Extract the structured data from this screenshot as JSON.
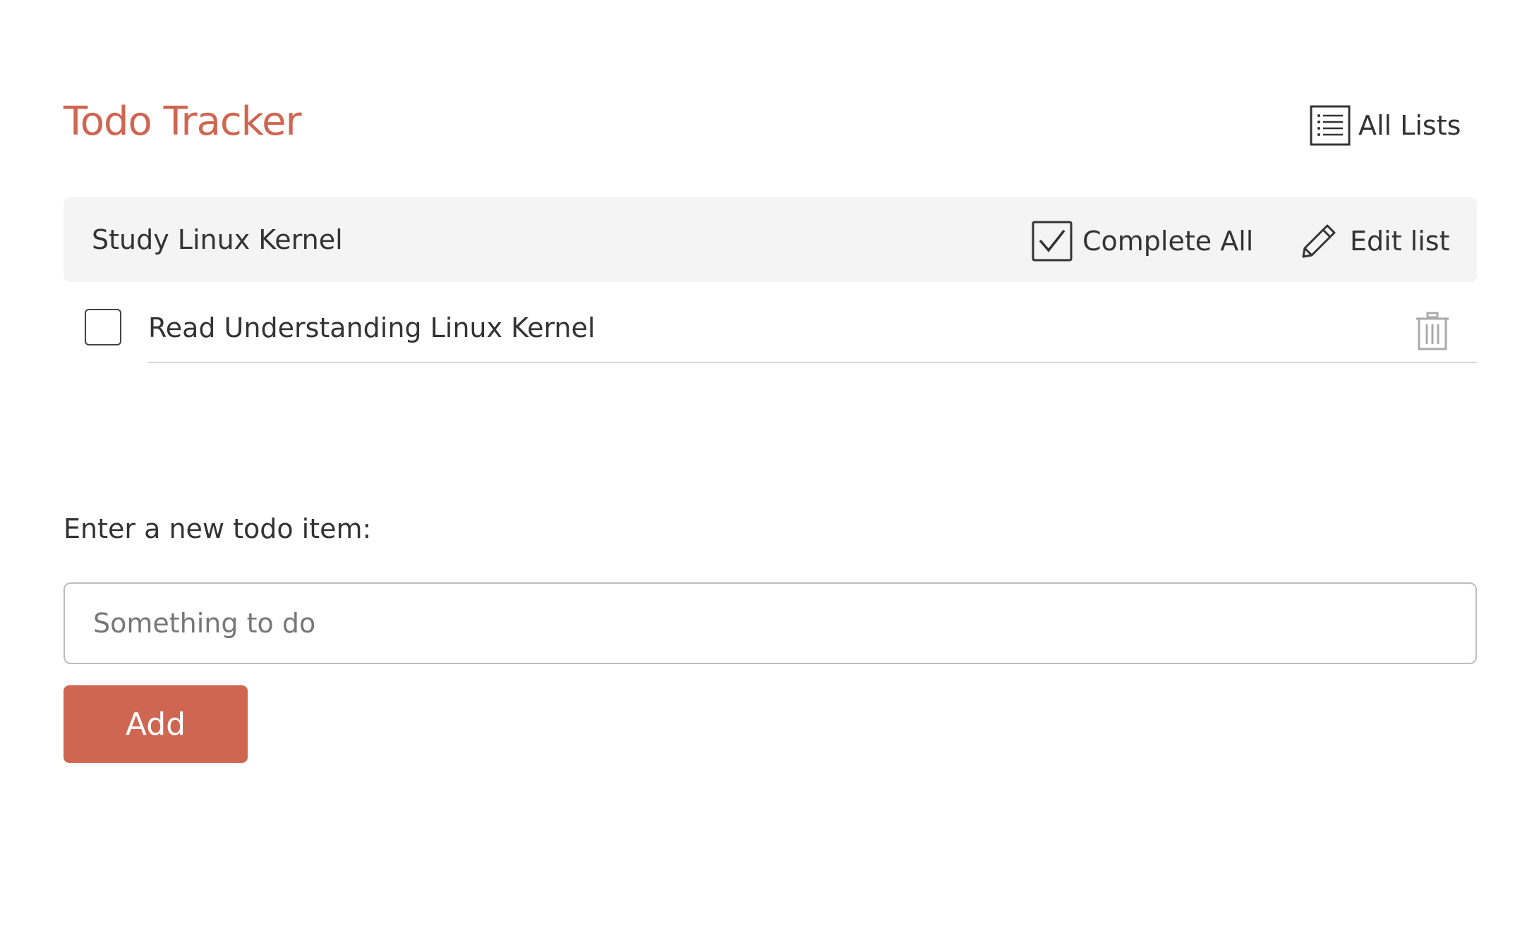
{
  "app": {
    "title": "Todo Tracker",
    "accent_color": "#cf6651"
  },
  "header": {
    "all_lists_label": "All Lists",
    "all_lists_icon": "list-icon"
  },
  "list": {
    "name": "Study Linux Kernel",
    "complete_all_label": "Complete All",
    "complete_all_icon": "checkbox-checked-icon",
    "edit_label": "Edit list",
    "edit_icon": "pencil-icon"
  },
  "todos": [
    {
      "text": "Read Understanding Linux Kernel",
      "completed": false,
      "delete_icon": "trash-icon"
    }
  ],
  "new_item": {
    "label": "Enter a new todo item:",
    "placeholder": "Something to do",
    "value": "",
    "add_label": "Add"
  }
}
